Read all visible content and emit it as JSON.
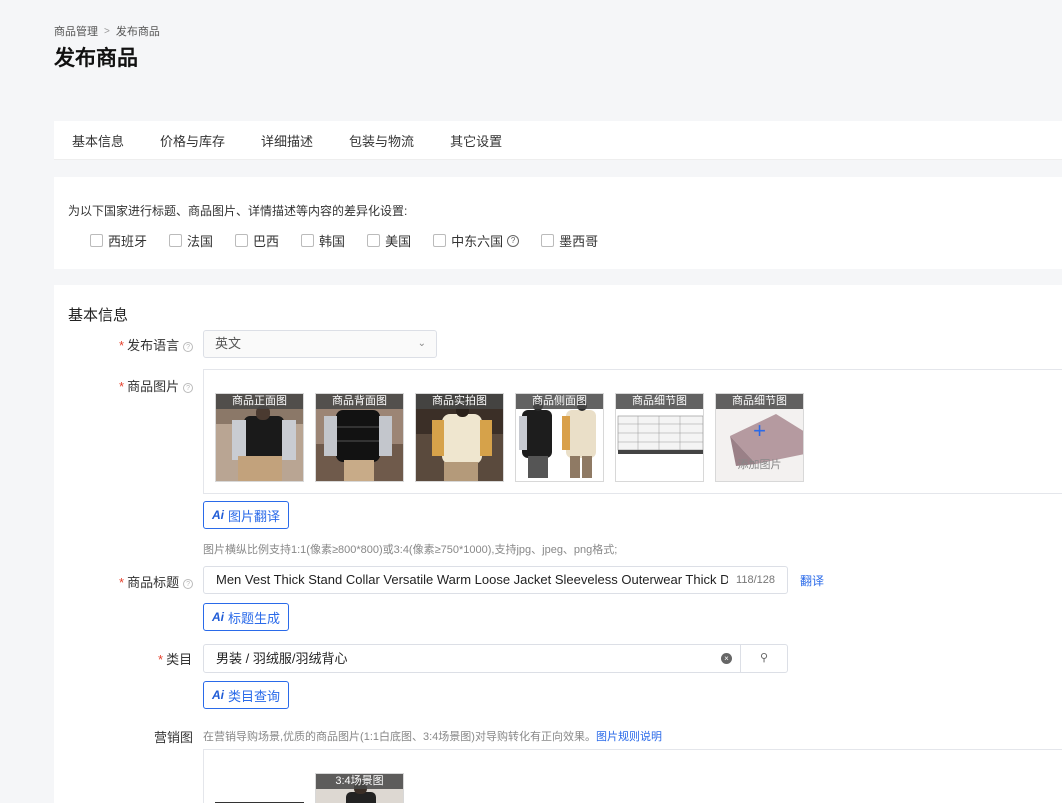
{
  "breadcrumb": {
    "parent": "商品管理",
    "separator": ">",
    "current": "发布商品"
  },
  "page_title": "发布商品",
  "tabs": [
    "基本信息",
    "价格与库存",
    "详细描述",
    "包装与物流",
    "其它设置"
  ],
  "country_section": {
    "hint": "为以下国家进行标题、商品图片、详情描述等内容的差异化设置:",
    "countries": [
      {
        "label": "西班牙",
        "checked": false
      },
      {
        "label": "法国",
        "checked": false
      },
      {
        "label": "巴西",
        "checked": false
      },
      {
        "label": "韩国",
        "checked": false
      },
      {
        "label": "美国",
        "checked": false
      },
      {
        "label": "中东六国",
        "checked": false,
        "has_help": true
      },
      {
        "label": "墨西哥",
        "checked": false
      }
    ]
  },
  "basic_info": {
    "section_title": "基本信息",
    "language": {
      "label": "发布语言",
      "required": true,
      "value": "英文"
    },
    "images": {
      "label": "商品图片",
      "required": true,
      "thumbnails": [
        {
          "label": "商品正面图",
          "icon": "black-vest-front-photo"
        },
        {
          "label": "商品背面图",
          "icon": "black-vest-back-photo"
        },
        {
          "label": "商品实拍图",
          "icon": "cream-vest-model-photo"
        },
        {
          "label": "商品侧面图",
          "icon": "vest-side-photo"
        },
        {
          "label": "商品细节图",
          "icon": "size-chart-photo"
        },
        {
          "label": "商品细节图",
          "icon": "add-image-slot",
          "add_text": "添加图片",
          "plus": "+"
        }
      ],
      "ai_button": "图片翻译",
      "hint": "图片横纵比例支持1:1(像素≥800*800)或3:4(像素≥750*1000),支持jpg、jpeg、png格式;"
    },
    "title": {
      "label": "商品标题",
      "required": true,
      "value": "Men Vest Thick Stand Collar Versatile Warm Loose Jacket Sleeveless Outerwear  Thick Down",
      "counter": "118/128",
      "translate": "翻译",
      "ai_button": "标题生成"
    },
    "category": {
      "label": "类目",
      "required": true,
      "value": "男装 / 羽绒服/羽绒背心",
      "clear_glyph": "×",
      "search_glyph": "⚲",
      "ai_button": "类目查询"
    },
    "marketing": {
      "label": "营销图",
      "hint": "在营销导购场景,优质的商品图片(1:1白底图、3:4场景图)对导购转化有正向效果。",
      "link": "图片规则说明",
      "thumb_label": "3:4场景图"
    }
  },
  "ai_icon_text": "Ai",
  "help_glyph": "?"
}
